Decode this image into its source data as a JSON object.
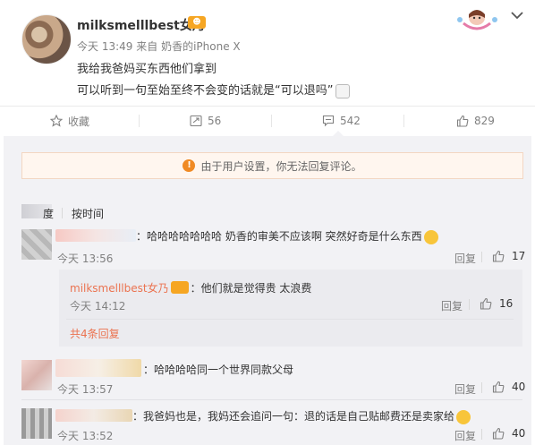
{
  "post": {
    "username": "milksmelllbest女乃",
    "vip_badge": "☻",
    "time": "今天 13:49",
    "source_prefix": "来自",
    "source": "奶香的iPhone X",
    "lines": [
      "我给我爸妈买东西他们拿到",
      "可以听到一句至始至终不会变的话就是“可以退吗”"
    ],
    "accent_color": "#eb7350"
  },
  "actions": {
    "favorite": "收藏",
    "repost_count": "56",
    "comment_count": "542",
    "like_count": "829"
  },
  "notice": {
    "icon": "!",
    "text": "由于用户设置，你无法回复评论。"
  },
  "sort": {
    "hot": "度",
    "by_time": "按时间"
  },
  "comments": [
    {
      "text": "：哈哈哈哈哈哈哈  奶香的审美不应该啊  突然好奇是什么东西",
      "time": "今天 13:56",
      "reply": "回复",
      "likes": "17"
    },
    {
      "text": "：哈哈哈哈同一个世界同款父母",
      "time": "今天 13:57",
      "reply": "回复",
      "likes": "40"
    },
    {
      "text": "：我爸妈也是，我妈还会追问一句：退的话是自己贴邮费还是卖家给",
      "time": "今天 13:52",
      "reply": "回复",
      "likes": "40"
    }
  ],
  "sub_reply": {
    "username": "milksmelllbest女乃",
    "text": "：他们就是觉得贵 太浪费",
    "time": "今天 14:12",
    "reply": "回复",
    "likes": "16",
    "more": "共4条回复"
  }
}
